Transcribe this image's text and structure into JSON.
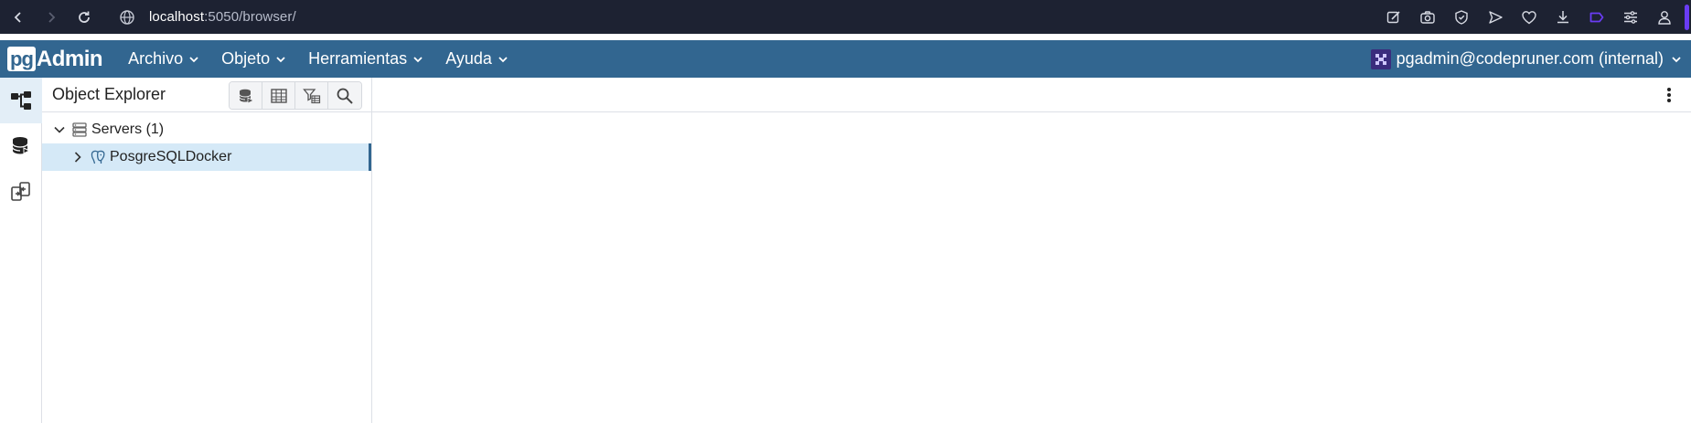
{
  "browser": {
    "url_host": "localhost",
    "url_path": ":5050/browser/",
    "toolbar_icons": [
      "edit-page-icon",
      "camera-icon",
      "shield-check-icon",
      "send-icon",
      "heart-icon",
      "download-icon",
      "tag-icon",
      "sliders-icon",
      "profile-icon"
    ]
  },
  "app": {
    "logo_pg": "pg",
    "logo_admin": "Admin",
    "menu": [
      {
        "label": "Archivo"
      },
      {
        "label": "Objeto"
      },
      {
        "label": "Herramientas"
      },
      {
        "label": "Ayuda"
      }
    ],
    "user": "pgadmin@codepruner.com (internal)"
  },
  "explorer": {
    "title": "Object Explorer",
    "tools": [
      "query-tool-icon",
      "table-view-icon",
      "filter-rows-icon",
      "search-icon"
    ],
    "tree": [
      {
        "label": "Servers (1)",
        "expanded": true
      },
      {
        "label": "PosgreSQLDocker",
        "expanded": false,
        "selected": true
      }
    ]
  },
  "colors": {
    "browser_bg": "#1d2232",
    "menubar_bg": "#326690",
    "selected_row": "#d5e9f7",
    "accent": "#6a3cf4"
  }
}
